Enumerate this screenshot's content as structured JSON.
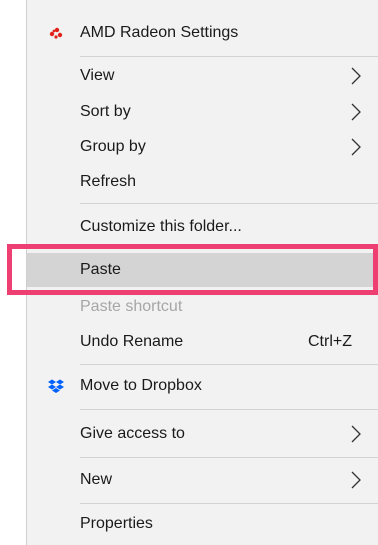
{
  "menu": {
    "amd": {
      "label": "AMD Radeon Settings",
      "icon": "amd-radeon-icon",
      "icon_color": "#e2231a"
    },
    "view": {
      "label": "View"
    },
    "sort_by": {
      "label": "Sort by"
    },
    "group_by": {
      "label": "Group by"
    },
    "refresh": {
      "label": "Refresh"
    },
    "customize": {
      "label": "Customize this folder..."
    },
    "paste": {
      "label": "Paste"
    },
    "paste_shortcut": {
      "label": "Paste shortcut"
    },
    "undo_rename": {
      "label": "Undo Rename",
      "shortcut": "Ctrl+Z"
    },
    "move_to_dropbox": {
      "label": "Move to Dropbox",
      "icon": "dropbox-icon",
      "icon_color": "#0061fe"
    },
    "give_access": {
      "label": "Give access to"
    },
    "new": {
      "label": "New"
    },
    "properties": {
      "label": "Properties"
    }
  },
  "highlight_color": "#ee3f73"
}
